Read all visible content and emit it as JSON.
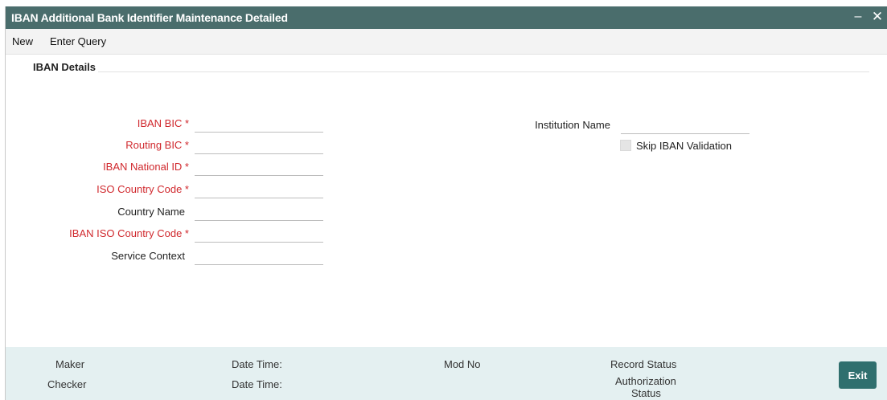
{
  "window": {
    "title": "IBAN Additional Bank Identifier Maintenance Detailed",
    "minimize_glyph": "–",
    "close_glyph": "✕"
  },
  "menu": {
    "items": [
      "New",
      "Enter Query"
    ]
  },
  "section": {
    "title": "IBAN Details"
  },
  "fields": {
    "iban_bic": {
      "label": "IBAN BIC *",
      "value": "",
      "required": true
    },
    "routing_bic": {
      "label": "Routing BIC *",
      "value": "",
      "required": true
    },
    "iban_national_id": {
      "label": "IBAN National ID *",
      "value": "",
      "required": true
    },
    "iso_country_code": {
      "label": "ISO Country Code *",
      "value": "",
      "required": true
    },
    "country_name": {
      "label": "Country Name",
      "value": "",
      "required": false
    },
    "iban_iso_country_code": {
      "label": "IBAN ISO Country Code *",
      "value": "",
      "required": true
    },
    "service_context": {
      "label": "Service Context",
      "value": "",
      "required": false
    },
    "institution_name": {
      "label": "Institution Name",
      "value": "",
      "required": false
    }
  },
  "skip_iban_validation": {
    "label": "Skip IBAN Validation",
    "checked": false
  },
  "footer": {
    "maker": "Maker",
    "checker": "Checker",
    "date_time_1": "Date Time:",
    "date_time_2": "Date Time:",
    "mod_no": "Mod No",
    "record_status": "Record Status",
    "authorization_status_line1": "Authorization",
    "authorization_status_line2": "Status",
    "exit_label": "Exit"
  },
  "colors": {
    "titlebar": "#4a6d6c",
    "required_label": "#d0282d",
    "footer_bg": "#e4f0f1",
    "exit_button": "#2f6f6e"
  }
}
